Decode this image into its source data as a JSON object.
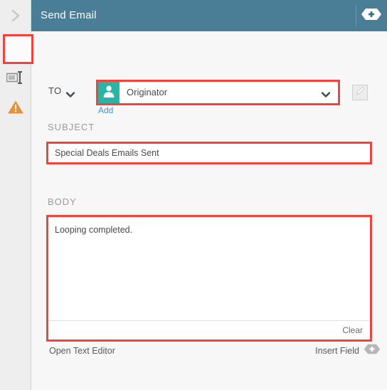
{
  "window": {
    "title": "Send Email"
  },
  "header": {
    "title": "Send Email",
    "add_icon": "plus-hexagon-icon"
  },
  "rail": {
    "expand_icon": "chevron-right-icon",
    "items": [
      {
        "icon": "envelope-icon",
        "name": "mail",
        "selected": true
      },
      {
        "icon": "input-field-icon",
        "name": "field",
        "selected": false
      },
      {
        "icon": "warning-triangle-icon",
        "name": "warning",
        "selected": false
      }
    ]
  },
  "form": {
    "to": {
      "label": "TO",
      "caret_icon": "chevron-down-icon",
      "avatar_icon": "person-icon",
      "value": "Originator",
      "dropdown_icon": "chevron-down-icon",
      "add_link": "Add",
      "edit_icon": "pencil-icon"
    },
    "subject": {
      "label": "SUBJECT",
      "value": "Special Deals Emails Sent",
      "placeholder": "Subject"
    },
    "body": {
      "label": "BODY",
      "value": "Looping completed.",
      "placeholder": "Body",
      "clear_label": "Clear"
    },
    "footer": {
      "open_text_editor": "Open Text Editor",
      "insert_field": "Insert Field",
      "insert_field_icon": "plus-hexagon-icon"
    }
  },
  "colors": {
    "header_bg": "#4a7e96",
    "rail_bg": "#eeeeee",
    "content_bg": "#f7f7f7",
    "highlight_red": "#f4433c",
    "avatar_teal": "#2bb3a3",
    "link_blue": "#3399dd",
    "envelope_orange": "#e3ab5c",
    "warning_orange": "#e8913c"
  }
}
